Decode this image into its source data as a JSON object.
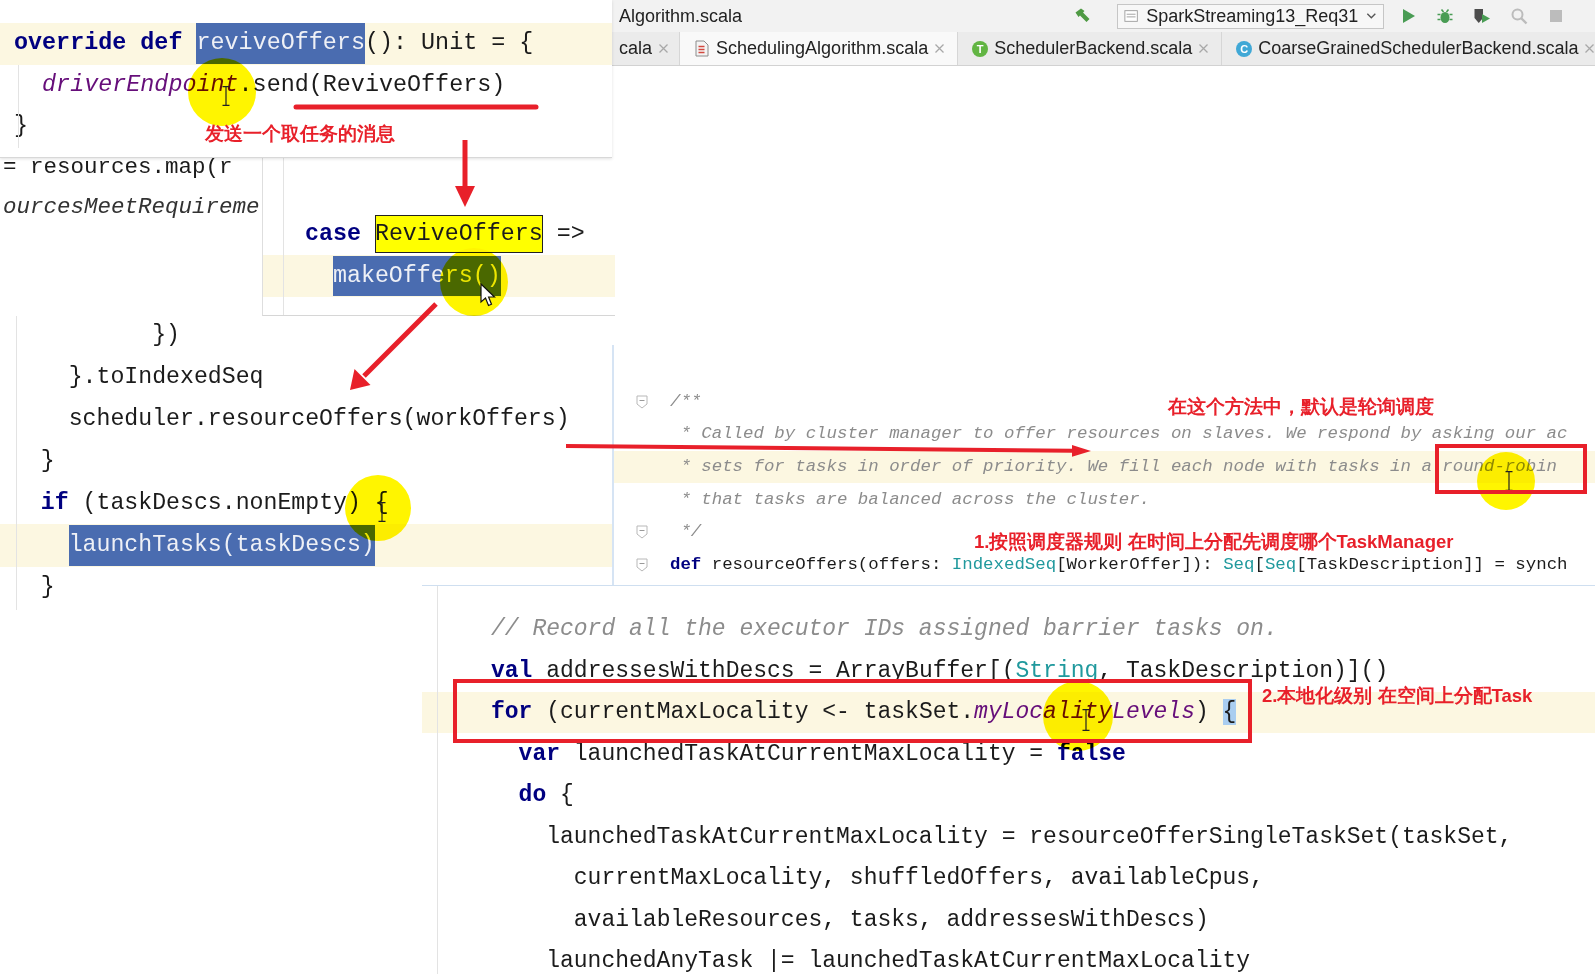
{
  "snippets": [
    {
      "lines": [
        {
          "current": true,
          "segments": [
            {
              "kind": "keyword",
              "text": "override def "
            },
            {
              "kind": "selection",
              "text": "reviveOffers"
            },
            {
              "kind": "plain",
              "text": "(): Unit = {"
            }
          ]
        },
        {
          "current": false,
          "segments": [
            {
              "kind": "field",
              "text": "  driverEndpoint"
            },
            {
              "kind": "plain",
              "text": ".send(ReviveOffers)"
            }
          ]
        },
        {
          "current": false,
          "segments": [
            {
              "kind": "plain",
              "text": "}"
            }
          ]
        }
      ]
    },
    {
      "lines": [
        {
          "current": false,
          "segments": [
            {
              "kind": "plain",
              "text": "= resources.map(r"
            }
          ]
        },
        {
          "current": false,
          "segments": [
            {
              "kind": "italic",
              "text": "ourcesMeetRequireme"
            }
          ]
        }
      ]
    },
    {
      "lines": [
        {
          "current": false,
          "segments": [
            {
              "kind": "keyword",
              "text": "case "
            },
            {
              "kind": "match",
              "text": "ReviveOffers"
            },
            {
              "kind": "plain",
              "text": " =>"
            }
          ]
        },
        {
          "current": true,
          "segments": [
            {
              "kind": "selection",
              "text": "  makeOffers()"
            }
          ]
        }
      ]
    },
    {
      "lines": [
        {
          "current": false,
          "segments": [
            {
              "kind": "plain",
              "text": "          })"
            }
          ]
        },
        {
          "current": false,
          "segments": [
            {
              "kind": "plain",
              "text": "    }.toIndexedSeq"
            }
          ]
        },
        {
          "current": false,
          "segments": [
            {
              "kind": "plain",
              "text": "    scheduler.resourceOffers(workOffers)"
            }
          ]
        },
        {
          "current": false,
          "segments": [
            {
              "kind": "plain",
              "text": "  }"
            }
          ]
        },
        {
          "current": false,
          "segments": [
            {
              "kind": "keyword",
              "text": "  if"
            },
            {
              "kind": "plain",
              "text": " (taskDescs.nonEmpty) {"
            }
          ]
        },
        {
          "current": true,
          "segments": [
            {
              "kind": "selection",
              "text": "    launchTasks(taskDescs)"
            }
          ]
        },
        {
          "current": false,
          "segments": [
            {
              "kind": "plain",
              "text": "  }"
            }
          ]
        }
      ]
    },
    {
      "lines": [
        {
          "current": false,
          "segments": [
            {
              "kind": "comment",
              "text": "// Record all the executor IDs assigned barrier tasks on."
            }
          ]
        },
        {
          "current": false,
          "segments": [
            {
              "kind": "keyword",
              "text": "val"
            },
            {
              "kind": "plain",
              "text": " addressesWithDescs = ArrayBuffer[("
            },
            {
              "kind": "type",
              "text": "String"
            },
            {
              "kind": "plain",
              "text": ", TaskDescription)]()"
            }
          ]
        },
        {
          "current": true,
          "segments": [
            {
              "kind": "keyword",
              "text": "for"
            },
            {
              "kind": "plain",
              "text": " (currentMaxLocality <- taskSet."
            },
            {
              "kind": "field",
              "text": "myLocalityLevels"
            },
            {
              "kind": "plain",
              "text": ") "
            },
            {
              "kind": "brace",
              "text": "{"
            }
          ]
        },
        {
          "current": false,
          "segments": [
            {
              "kind": "keyword",
              "text": "  var"
            },
            {
              "kind": "plain",
              "text": " launchedTaskAtCurrentMaxLocality = "
            },
            {
              "kind": "keyword",
              "text": "false"
            }
          ]
        },
        {
          "current": false,
          "segments": [
            {
              "kind": "keyword",
              "text": "  do"
            },
            {
              "kind": "plain",
              "text": " {"
            }
          ]
        },
        {
          "current": false,
          "segments": [
            {
              "kind": "plain",
              "text": "    launchedTaskAtCurrentMaxLocality = resourceOfferSingleTaskSet(taskSet,"
            }
          ]
        },
        {
          "current": false,
          "segments": [
            {
              "kind": "plain",
              "text": "      currentMaxLocality, shuffledOffers, availableCpus,"
            }
          ]
        },
        {
          "current": false,
          "segments": [
            {
              "kind": "plain",
              "text": "      availableResources, tasks, addressesWithDescs)"
            }
          ]
        },
        {
          "current": false,
          "segments": [
            {
              "kind": "plain",
              "text": "    launchedAnyTask |= launchedTaskAtCurrentMaxLocality"
            }
          ]
        }
      ]
    }
  ],
  "ide_window": {
    "title": "Algorithm.scala",
    "build_button": {
      "kind": "build",
      "disabled": false
    },
    "run_configuration": "SparkStreaming13_Req31",
    "toolbar_buttons": [
      {
        "kind": "run",
        "disabled": false
      },
      {
        "kind": "debug",
        "disabled": false
      },
      {
        "kind": "coverage",
        "disabled": false
      },
      {
        "kind": "profile",
        "disabled": true
      },
      {
        "kind": "stop",
        "disabled": true
      }
    ],
    "tabs": [
      {
        "kind": "plain",
        "label": "cala",
        "selected": false
      },
      {
        "kind": "file",
        "label": "SchedulingAlgorithm.scala",
        "selected": true
      },
      {
        "kind": "trait",
        "badge": "T",
        "label": "SchedulerBackend.scala",
        "selected": false
      },
      {
        "kind": "class",
        "badge": "C",
        "label": "CoarseGrainedSchedulerBackend.scala",
        "selected": false
      }
    ],
    "code_lines": [
      {
        "current": false,
        "foldable": true,
        "segments": [
          {
            "kind": "comment",
            "text": "/**"
          }
        ]
      },
      {
        "current": false,
        "foldable": false,
        "segments": [
          {
            "kind": "comment",
            "text": " * Called by cluster manager to offer resources on slaves. We respond by asking our ac"
          }
        ]
      },
      {
        "current": true,
        "foldable": false,
        "segments": [
          {
            "kind": "comment",
            "text": " * sets for tasks in order of priority. We fill each node with tasks in a round-robin"
          }
        ]
      },
      {
        "current": false,
        "foldable": false,
        "segments": [
          {
            "kind": "comment",
            "text": " * that tasks are balanced across the cluster."
          }
        ]
      },
      {
        "current": false,
        "foldable": true,
        "segments": [
          {
            "kind": "comment",
            "text": " */"
          }
        ]
      },
      {
        "current": false,
        "foldable": true,
        "segments": [
          {
            "kind": "keyword",
            "text": "def"
          },
          {
            "kind": "plain",
            "text": " resourceOffers(offers: "
          },
          {
            "kind": "type",
            "text": "IndexedSeq"
          },
          {
            "kind": "plain",
            "text": "[WorkerOffer]): "
          },
          {
            "kind": "type",
            "text": "Seq"
          },
          {
            "kind": "plain",
            "text": "["
          },
          {
            "kind": "type",
            "text": "Seq"
          },
          {
            "kind": "plain",
            "text": "[TaskDescription]] = synch"
          }
        ]
      }
    ]
  },
  "annotations": [
    "发送一个取任务的消息",
    "在这个方法中，默认是轮询调度",
    "1.按照调度器规则 在时间上分配先调度哪个TaskManager",
    "2.本地化级别 在空间上分配Task"
  ]
}
